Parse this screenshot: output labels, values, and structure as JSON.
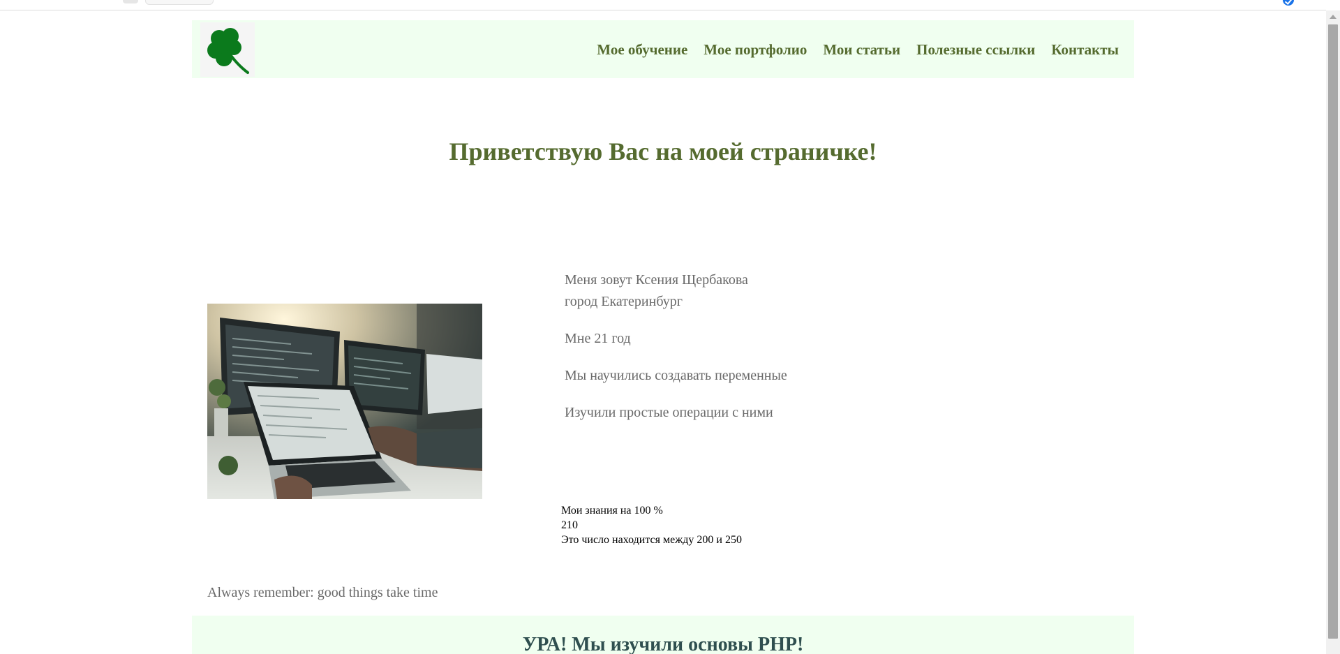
{
  "nav": {
    "items": [
      {
        "label": "Мое обучение"
      },
      {
        "label": "Мое портфолио"
      },
      {
        "label": "Мои статьи"
      },
      {
        "label": "Полезные ссылки"
      },
      {
        "label": "Контакты"
      }
    ]
  },
  "hero": {
    "title": "Приветствую Вас на моей страничке!"
  },
  "about": {
    "name_line": "Меня зовут Ксения Щербакова",
    "city_line": "город Екатеринбург",
    "age_line": "Мне 21 год",
    "learned_vars": "Мы научились создавать переменные",
    "learned_ops": "Изучили простые операции с ними"
  },
  "stats": {
    "knowledge": "Мои знания на 100 %",
    "number": "210",
    "range_text": "Это число находится между 200 и 250"
  },
  "motto": "Always remember: good things take time",
  "footer": {
    "text": "УРА! Мы изучили основы PHP!"
  },
  "icons": {
    "logo": "four-leaf-clover-icon",
    "photo": "laptop-coding-photo"
  },
  "colors": {
    "header_bg": "#f0fff0",
    "nav_text": "#556b2f",
    "title": "#556b2f",
    "body_text": "#696969",
    "footer_text": "#2f4f4f",
    "clover": "#0b7a1c"
  }
}
